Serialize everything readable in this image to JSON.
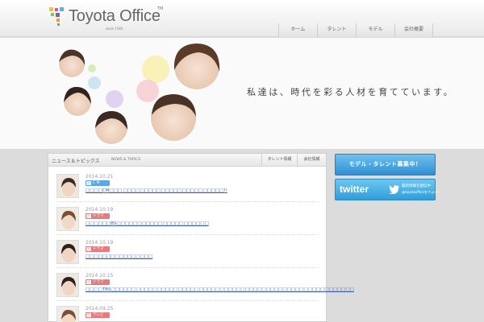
{
  "header": {
    "logo_text": "Toyota Office",
    "logo_tm": "TM",
    "logo_since": "since 1984",
    "nav": [
      "ホーム",
      "タレント",
      "モデル",
      "会社概要"
    ]
  },
  "hero": {
    "copy": "私達は、時代を彩る人材を育てています。"
  },
  "news": {
    "title": "ニュース＆トピックス",
    "subtitle": "NEWS & TOPICS",
    "tabs": [
      "タレント情報",
      "会社情報"
    ],
    "items": [
      {
        "date": "2014.10.21",
        "badge": "C M",
        "badge_color": "#5aa6e6",
        "link": "□□□□CM□□□ □□□□□□□□□□□□□□□□□□□□□□□□!!"
      },
      {
        "date": "2014.10.19",
        "badge": "ドラマ",
        "badge_color": "#e8797c",
        "link": "□□□□□□BS□□□□□□□□□□□□□□□□□□□□□□"
      },
      {
        "date": "2014.10.19",
        "badge": "ドラマ",
        "badge_color": "#e8797c",
        "link": "□□□□□□□□□□□□□□□□"
      },
      {
        "date": "2014.10.15",
        "badge": "ドラマ",
        "badge_color": "#e8797c",
        "link": "□□□□TBS□□□□□□□□□□□□□□□□□□□□□□□□□□□□□□□□□□□□□□□□□□□□□□□□□□□□□□□□□□"
      },
      {
        "date": "2014.09.25",
        "badge": "テレビ",
        "badge_color": "#e8797c",
        "link": ""
      }
    ]
  },
  "banners": {
    "model": "モデル・タレント募集中！",
    "twitter_word": "twitter",
    "twitter_note1": "最新情報を配信中",
    "twitter_note2": "@toyotaofficeをフォロー"
  }
}
